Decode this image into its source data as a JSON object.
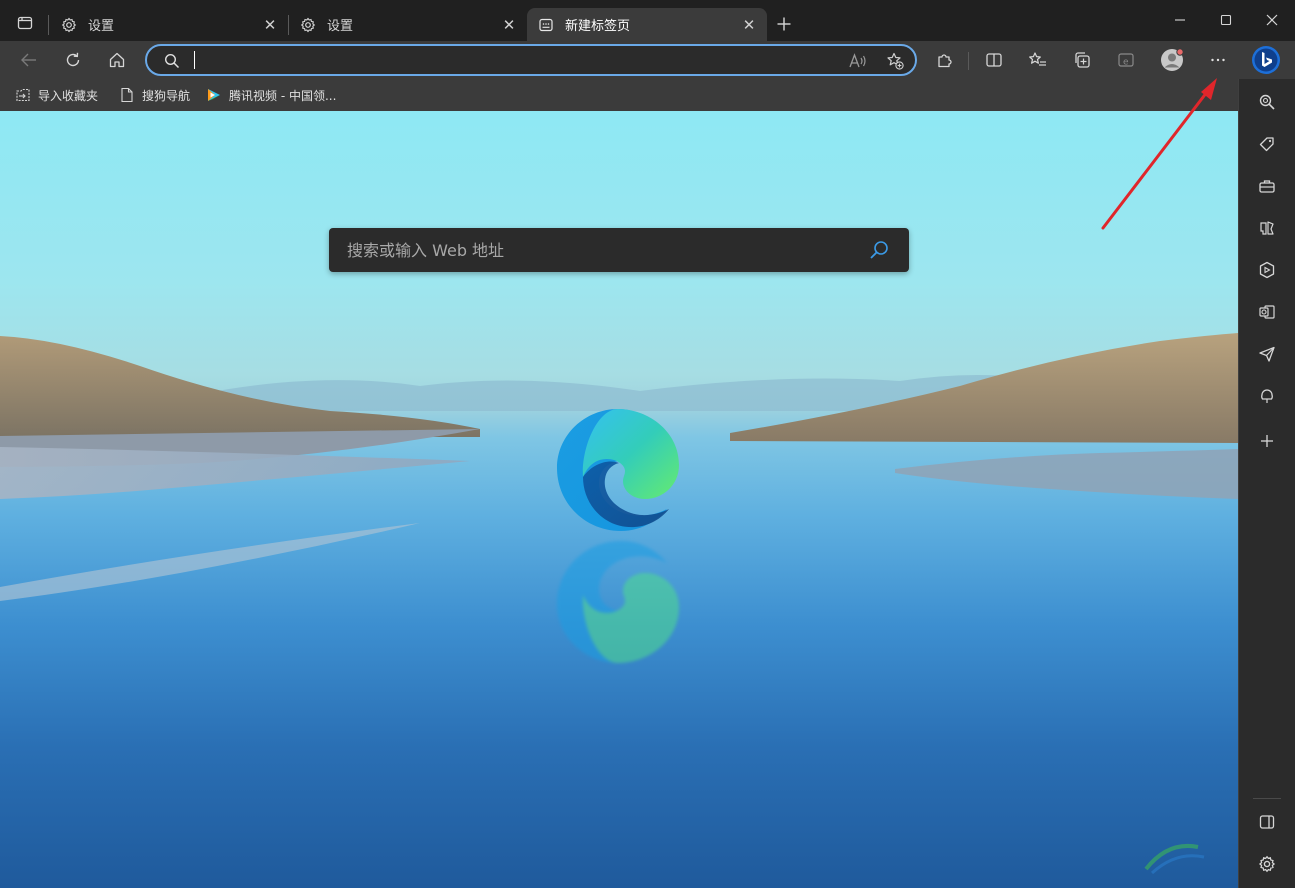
{
  "tabs": [
    {
      "title": "设置",
      "icon": "gear-icon",
      "active": false
    },
    {
      "title": "设置",
      "icon": "gear-icon",
      "active": false
    },
    {
      "title": "新建标签页",
      "icon": "new-tab-page-icon",
      "active": true
    }
  ],
  "tab_close_glyph": "✕",
  "address_bar": {
    "value": "",
    "placeholder": ""
  },
  "favorites": [
    {
      "label": "导入收藏夹",
      "icon": "import-favorites-icon"
    },
    {
      "label": "搜狗导航",
      "icon": "page-icon"
    },
    {
      "label": "腾讯视频 - 中国领...",
      "icon": "tencent-video-icon"
    }
  ],
  "ntp": {
    "search_placeholder": "搜索或输入 Web 地址"
  },
  "colors": {
    "accent": "#6aa9e8",
    "tab_strip": "#202020",
    "toolbar": "#3b3b3b",
    "sidebar": "#2b2b2b",
    "arrow": "#e0262b"
  },
  "sidebar_icons": [
    "search-icon",
    "tag-icon",
    "toolbox-icon",
    "games-icon",
    "microsoft-365-icon",
    "outlook-icon",
    "send-icon",
    "drop-icon",
    "add-icon",
    "hide-sidebar-icon",
    "settings-icon"
  ]
}
